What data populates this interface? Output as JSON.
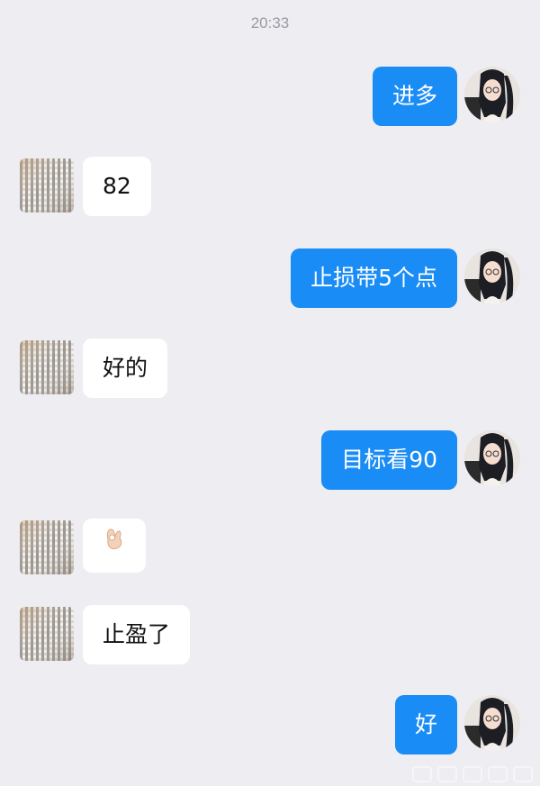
{
  "chat": {
    "timestamp": "20:33",
    "messages": [
      {
        "side": "right",
        "text": "进多"
      },
      {
        "side": "left",
        "text": "82"
      },
      {
        "side": "right",
        "text": "止损带5个点"
      },
      {
        "side": "left",
        "text": "好的"
      },
      {
        "side": "right",
        "text": "目标看90"
      },
      {
        "side": "left",
        "emoji": "ok-hand-icon"
      },
      {
        "side": "left",
        "text": "止盈了"
      },
      {
        "side": "right",
        "text": "好"
      }
    ]
  },
  "colors": {
    "background": "#ededf2",
    "sent_bubble": "#1a8cf5",
    "received_bubble": "#ffffff",
    "timestamp_text": "#9a9ca3"
  }
}
